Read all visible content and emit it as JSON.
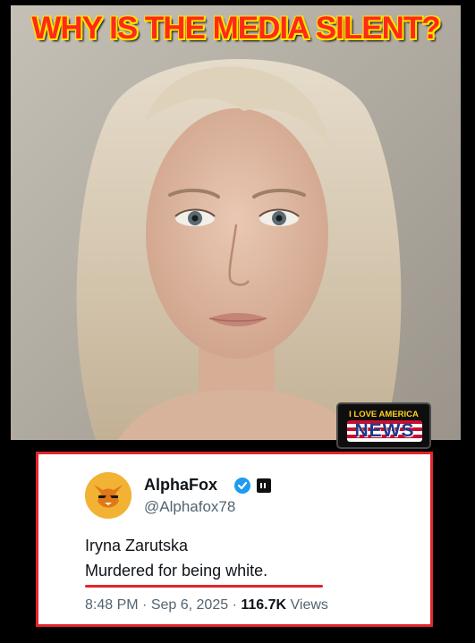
{
  "headline": "WHY IS THE MEDIA SILENT?",
  "logo": {
    "top_text": "I LOVE AMERICA",
    "word": "NEWS"
  },
  "tweet": {
    "author_name": "AlphaFox",
    "handle": "@Alphafox78",
    "text_line_1": "Iryna Zarutska",
    "text_line_2": "Murdered for being white.",
    "time": "8:48 PM",
    "separator": "·",
    "date": "Sep 6, 2025",
    "views_count": "116.7K",
    "views_label": "Views"
  },
  "icons": {
    "verified": "verified-badge-icon",
    "affiliate": "affiliate-badge-icon",
    "avatar": "fox-avatar"
  },
  "colors": {
    "headline": "#ff2a18",
    "headline_outline": "#ffe400",
    "frame_red": "#e3242b",
    "verified_blue": "#1d9bf0",
    "background": "#000000"
  }
}
